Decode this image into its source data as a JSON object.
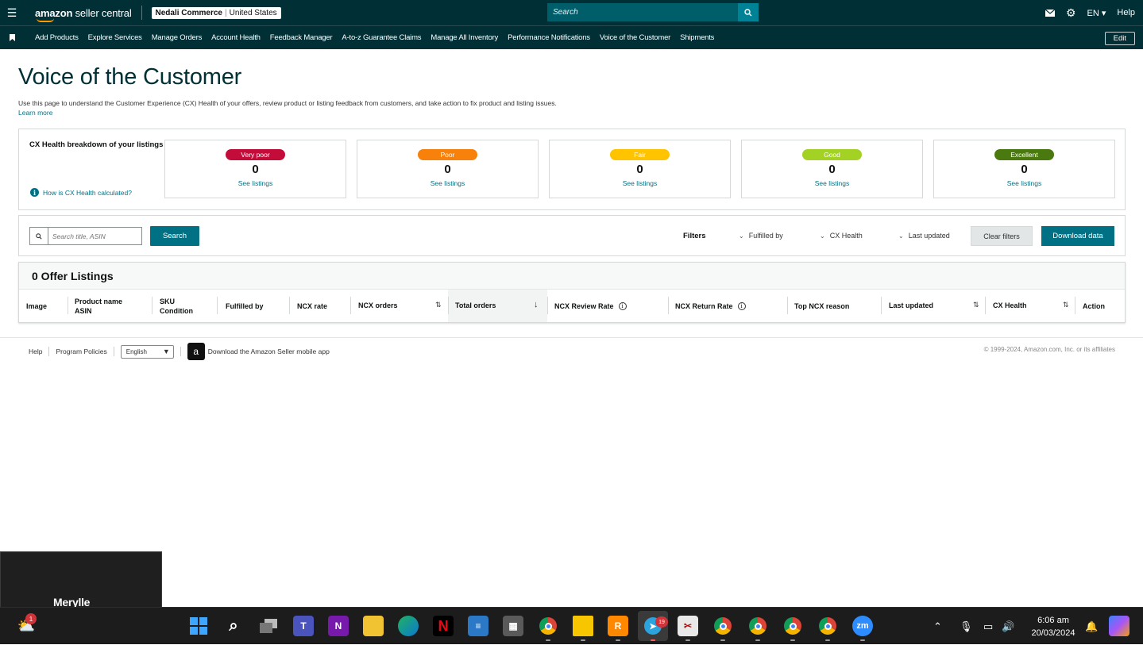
{
  "topbar": {
    "logo_main": "amazon",
    "logo_sub": " seller central",
    "account_name": "Nedali Commerce",
    "account_region": "United States",
    "search_placeholder": "Search",
    "language": "EN",
    "help": "Help"
  },
  "nav": {
    "items": [
      "Add Products",
      "Explore Services",
      "Manage Orders",
      "Account Health",
      "Feedback Manager",
      "A-to-z Guarantee Claims",
      "Manage All Inventory",
      "Performance Notifications",
      "Voice of the Customer",
      "Shipments"
    ],
    "edit": "Edit"
  },
  "page": {
    "title": "Voice of the Customer",
    "description": "Use this page to understand the Customer Experience (CX) Health of your offers, review product or listing feedback from customers, and take action to fix product and listing issues.",
    "learn_more": "Learn more"
  },
  "cx": {
    "title": "CX Health breakdown of your listings",
    "how_link": "How is CX Health calculated?",
    "cards": [
      {
        "label": "Very poor",
        "count": "0",
        "link": "See listings",
        "color": "#c40c3b"
      },
      {
        "label": "Poor",
        "count": "0",
        "link": "See listings",
        "color": "#f7810b"
      },
      {
        "label": "Fair",
        "count": "0",
        "link": "See listings",
        "color": "#ffc300"
      },
      {
        "label": "Good",
        "count": "0",
        "link": "See listings",
        "color": "#a3d225"
      },
      {
        "label": "Excellent",
        "count": "0",
        "link": "See listings",
        "color": "#4a7a0f"
      }
    ]
  },
  "search": {
    "placeholder": "Search title, ASIN",
    "button": "Search",
    "filters_label": "Filters",
    "filter_fulfilled": "Fulfilled by",
    "filter_cx": "CX Health",
    "filter_updated": "Last updated",
    "clear": "Clear filters",
    "download": "Download data"
  },
  "table": {
    "heading": "0 Offer Listings",
    "col_image": "Image",
    "col_product_1": "Product name",
    "col_product_2": "ASIN",
    "col_sku_1": "SKU",
    "col_sku_2": "Condition",
    "col_fulfilled": "Fulfilled by",
    "col_ncx_rate": "NCX rate",
    "col_ncx_orders": "NCX orders",
    "col_total_orders": "Total orders",
    "col_review_rate": "NCX Review Rate",
    "col_return_rate": "NCX Return Rate",
    "col_top_reason": "Top NCX reason",
    "col_last_updated": "Last updated",
    "col_cx_health": "CX Health",
    "col_action": "Action"
  },
  "footer": {
    "help": "Help",
    "policies": "Program Policies",
    "language": "English",
    "app": "Download the Amazon Seller mobile app",
    "copyright": "© 1999-2024, Amazon.com, Inc. or its affiliates"
  },
  "overlay": {
    "name": "Merylle"
  },
  "taskbar": {
    "weather_badge": "1",
    "telegram_badge": "19",
    "time": "6:06 am",
    "date": "20/03/2024"
  }
}
